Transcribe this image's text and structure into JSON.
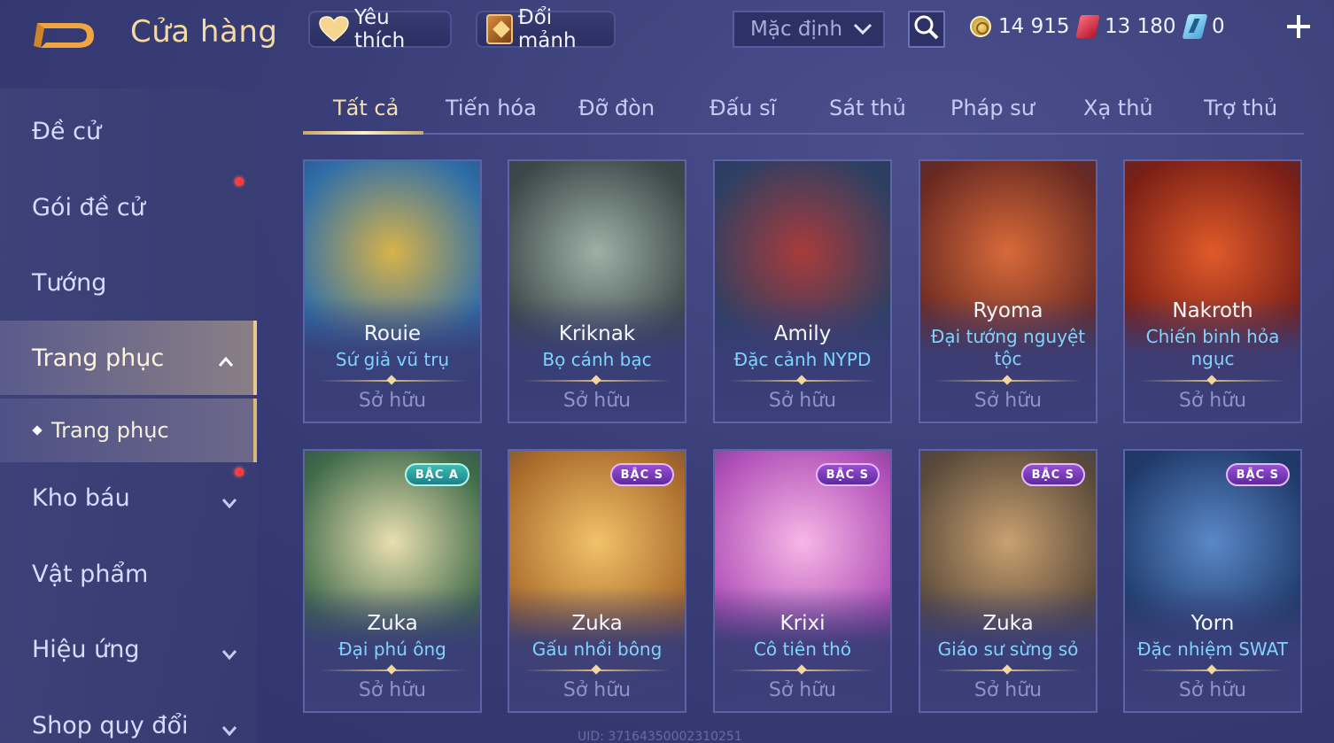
{
  "header": {
    "title": "Cửa hàng",
    "favorites_label": "Yêu thích",
    "exchange_label": "Đổi mảnh",
    "sort_value": "Mặc định",
    "currencies": [
      {
        "icon": "gold-coin-icon",
        "amount": "14 915"
      },
      {
        "icon": "voucher-icon",
        "amount": "13 180"
      },
      {
        "icon": "crystal-icon",
        "amount": "0"
      }
    ]
  },
  "sidebar": {
    "items": [
      {
        "label": "Đề cử"
      },
      {
        "label": "Gói đề cử"
      },
      {
        "label": "Tướng"
      },
      {
        "label": "Trang phục"
      },
      {
        "label": "Kho báu"
      },
      {
        "label": "Vật phẩm"
      },
      {
        "label": "Hiệu ứng"
      },
      {
        "label": "Shop quy đổi"
      }
    ],
    "sub_item": "Trang phục"
  },
  "tabs": [
    "Tất cả",
    "Tiến hóa",
    "Đỡ đòn",
    "Đấu sĩ",
    "Sát thủ",
    "Pháp sư",
    "Xạ thủ",
    "Trợ thủ"
  ],
  "cards": [
    {
      "hero": "Rouie",
      "skin": "Sứ giả vũ trụ",
      "status": "Sở hữu",
      "rank": "",
      "colors": [
        "#2f6ea8",
        "#d7b34a"
      ]
    },
    {
      "hero": "Kriknak",
      "skin": "Bọ cánh bạc",
      "status": "Sở hữu",
      "rank": "",
      "colors": [
        "#3c4a48",
        "#9fb0a8"
      ]
    },
    {
      "hero": "Amily",
      "skin": "Đặc cảnh NYPD",
      "status": "Sở hữu",
      "rank": "",
      "colors": [
        "#2c3f63",
        "#a83b3b"
      ]
    },
    {
      "hero": "Ryoma",
      "skin": "Đại tướng nguyệt tộc",
      "status": "Sở hữu",
      "rank": "",
      "colors": [
        "#6a2a22",
        "#d86a3a"
      ]
    },
    {
      "hero": "Nakroth",
      "skin": "Chiến binh hỏa ngục",
      "status": "Sở hữu",
      "rank": "",
      "colors": [
        "#7a1f16",
        "#e05a2a"
      ]
    },
    {
      "hero": "Zuka",
      "skin": "Đại phú ông",
      "status": "Sở hữu",
      "rank": "BẬC A",
      "colors": [
        "#3f6a4a",
        "#e9dfb0"
      ]
    },
    {
      "hero": "Zuka",
      "skin": "Gấu nhồi bông",
      "status": "Sở hữu",
      "rank": "BẬC S",
      "colors": [
        "#a86a2a",
        "#f2c26a"
      ]
    },
    {
      "hero": "Krixi",
      "skin": "Cô tiên thỏ",
      "status": "Sở hữu",
      "rank": "BẬC S",
      "colors": [
        "#b04fb8",
        "#f7b7e6"
      ]
    },
    {
      "hero": "Zuka",
      "skin": "Giáo sư sừng sỏ",
      "status": "Sở hữu",
      "rank": "BẬC S",
      "colors": [
        "#5a4a3a",
        "#c9a070"
      ]
    },
    {
      "hero": "Yorn",
      "skin": "Đặc nhiệm SWAT",
      "status": "Sở hữu",
      "rank": "BẬC S",
      "colors": [
        "#1f3a6a",
        "#5a88c8"
      ]
    }
  ],
  "watermark": "UID: 37164350002310251"
}
